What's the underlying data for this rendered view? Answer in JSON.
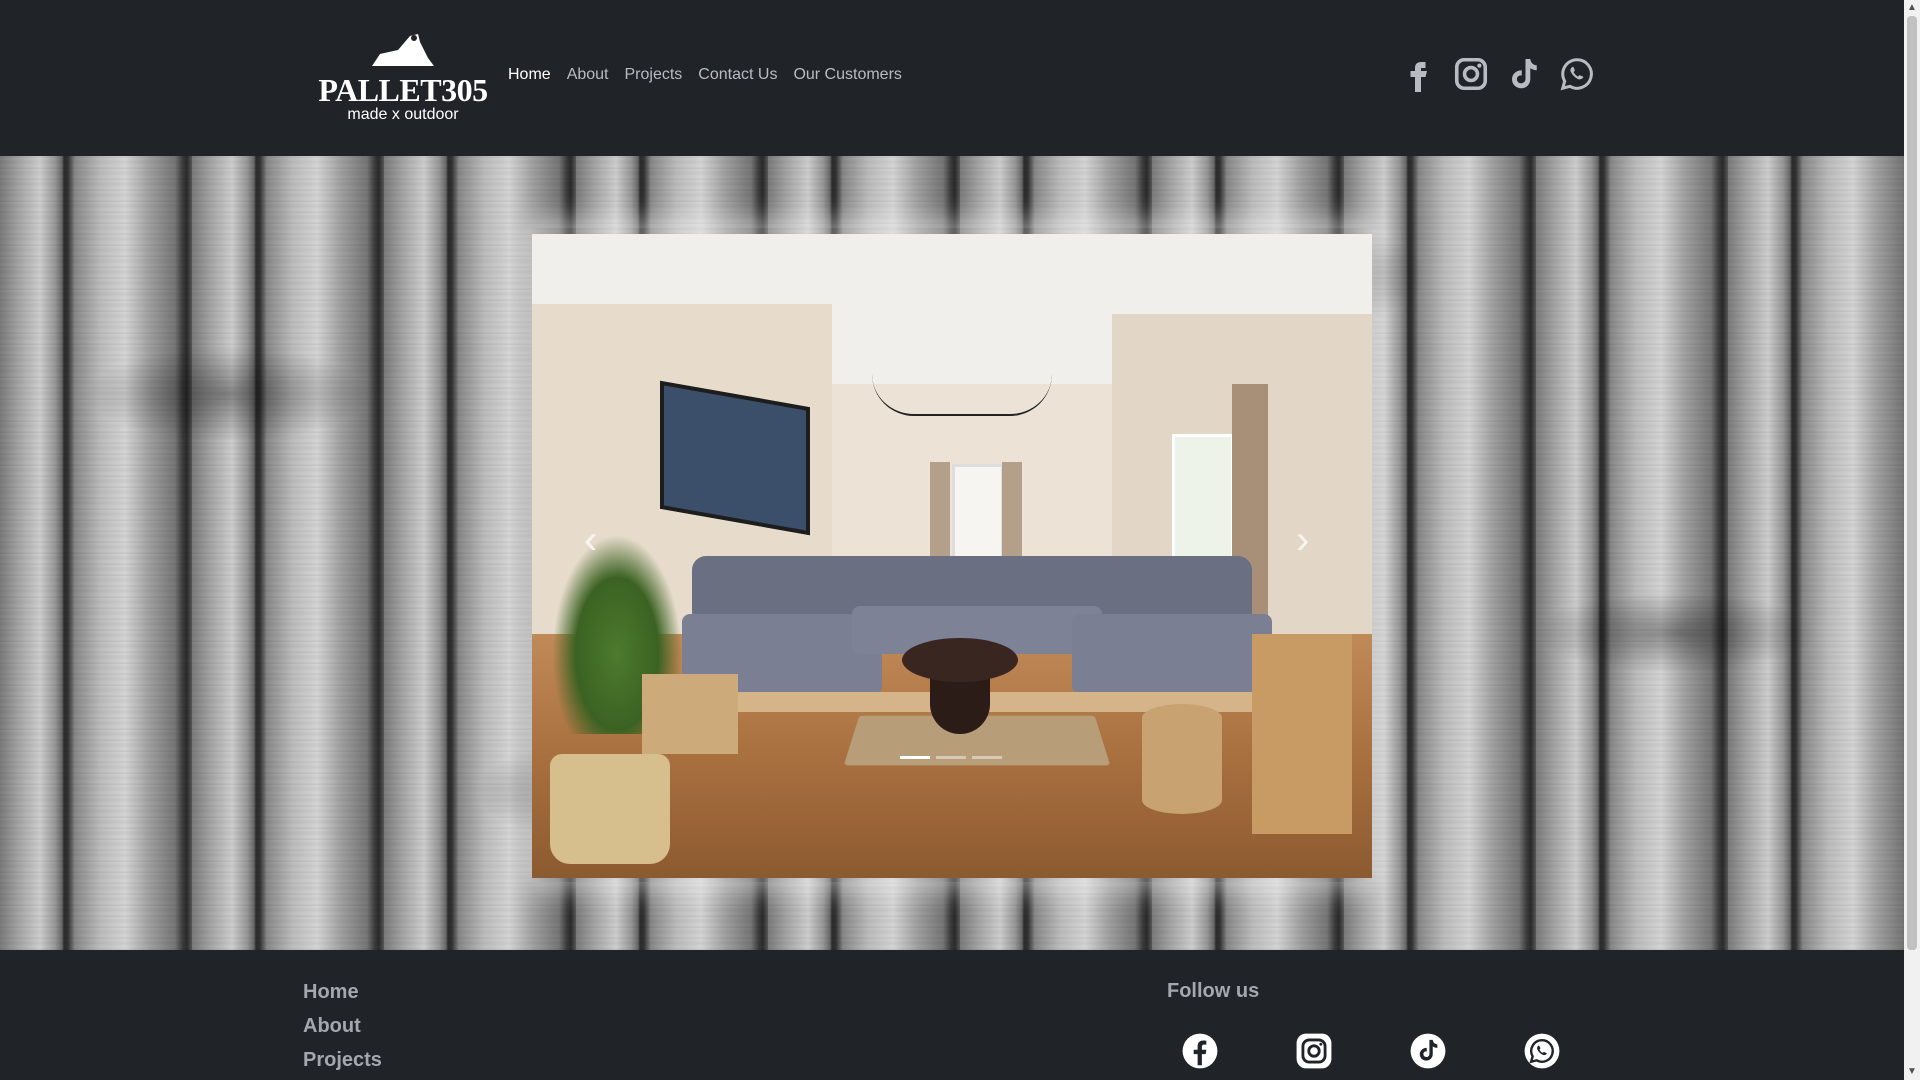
{
  "brand": {
    "name": "PALLET305",
    "tagline": "made x outdoor",
    "color_primary": "#ffffff",
    "background": "#202328"
  },
  "nav": {
    "items": [
      {
        "label": "Home",
        "active": true
      },
      {
        "label": "About",
        "active": false
      },
      {
        "label": "Projects",
        "active": false
      },
      {
        "label": "Contact Us",
        "active": false
      },
      {
        "label": "Our Customers",
        "active": false
      }
    ],
    "color_inactive": "#b8bcc2",
    "color_active": "#ffffff"
  },
  "social_header": {
    "icons": [
      "facebook-icon",
      "instagram-icon",
      "tiktok-icon",
      "whatsapp-icon"
    ],
    "color": "#b8bcc2"
  },
  "slideshow": {
    "current_slide": 1,
    "total_slides": 3,
    "prev_glyph": "‹",
    "next_glyph": "›"
  },
  "footer": {
    "links": [
      {
        "label": "Home"
      },
      {
        "label": "About"
      },
      {
        "label": "Projects"
      }
    ],
    "follow_label": "Follow us",
    "social_icons": [
      "facebook-icon",
      "instagram-icon",
      "tiktok-icon",
      "whatsapp-icon"
    ],
    "link_color": "#a3a7ae"
  },
  "scrollbar": {
    "up_glyph": "▲",
    "down_glyph": "▼"
  }
}
